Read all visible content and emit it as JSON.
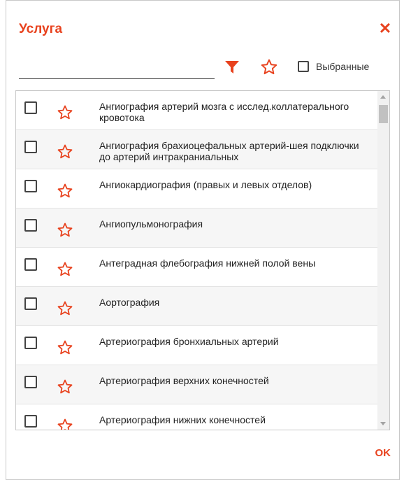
{
  "dialog": {
    "title": "Услуга",
    "close_icon": "close-icon",
    "ok_label": "OK"
  },
  "toolbar": {
    "search_value": "",
    "search_placeholder": "",
    "filter_icon": "filter-icon",
    "favorite_icon": "star-outline-icon",
    "selected_label": "Выбранные",
    "selected_checked": false
  },
  "colors": {
    "accent": "#e8421e",
    "text": "#222222",
    "row_alt": "#f6f6f6"
  },
  "services": [
    {
      "label": "Ангиография артерий мозга с исслед.коллатерального кровотока",
      "checked": false,
      "favorite": false
    },
    {
      "label": "Ангиография брахиоцефальных артерий-шея подключки до артерий интракраниальных",
      "checked": false,
      "favorite": false
    },
    {
      "label": "Ангиокардиография (правых и левых отделов)",
      "checked": false,
      "favorite": false
    },
    {
      "label": "Ангиопульмонография",
      "checked": false,
      "favorite": false
    },
    {
      "label": "Антеградная флебография нижней полой вены",
      "checked": false,
      "favorite": false
    },
    {
      "label": "Аортография",
      "checked": false,
      "favorite": false
    },
    {
      "label": "Артериография бронхиальных артерий",
      "checked": false,
      "favorite": false
    },
    {
      "label": "Артериография верхних конечностей",
      "checked": false,
      "favorite": false
    },
    {
      "label": "Артериография нижних конечностей",
      "checked": false,
      "favorite": false
    }
  ]
}
